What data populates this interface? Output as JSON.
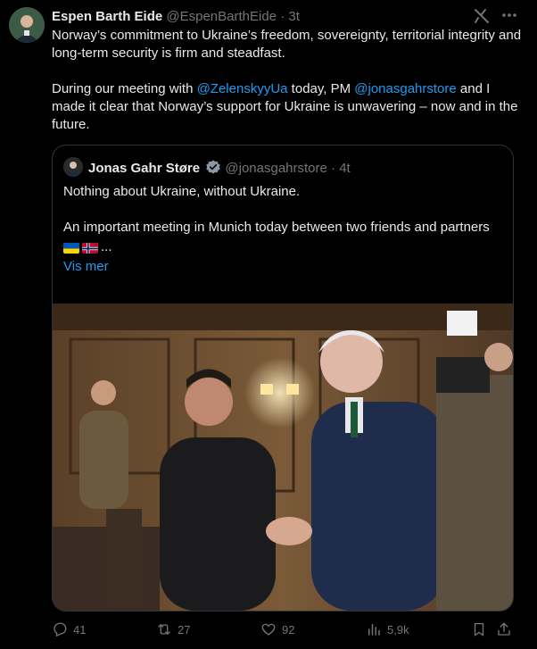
{
  "post": {
    "author_name": "Espen Barth Eide",
    "author_handle": "@EspenBarthEide",
    "separator": "·",
    "time": "3t",
    "text_line1": "Norway’s commitment to Ukraine’s freedom, sovereignty, territorial integrity and long-term security is firm and steadfast.",
    "text2_part1": "During our meeting with ",
    "mention1": "@ZelenskyyUa",
    "text2_part2": " today, PM ",
    "mention2": "@jonasgahrstore",
    "text2_part3": " and I made it clear that Norway’s support for Ukraine is unwavering – now and in the future."
  },
  "quote": {
    "author_name": "Jonas Gahr Støre",
    "author_handle": "@jonasgahrstore",
    "separator": "·",
    "time": "4t",
    "text_line1": "Nothing about Ukraine, without Ukraine.",
    "text_line2": "An important meeting in Munich today between two friends and partners",
    "ellipsis": "...",
    "show_more": "Vis mer"
  },
  "actions": {
    "replies": "41",
    "reposts": "27",
    "likes": "92",
    "views": "5,9k"
  },
  "icons": [
    "grok-icon",
    "more-icon",
    "verified-icon",
    "reply-icon",
    "repost-icon",
    "like-icon",
    "views-icon",
    "bookmark-icon",
    "share-icon"
  ],
  "colors": {
    "background": "#000000",
    "text": "#e7e9ea",
    "secondary": "#71767b",
    "link": "#1d9bf0",
    "border": "#2f3336"
  }
}
